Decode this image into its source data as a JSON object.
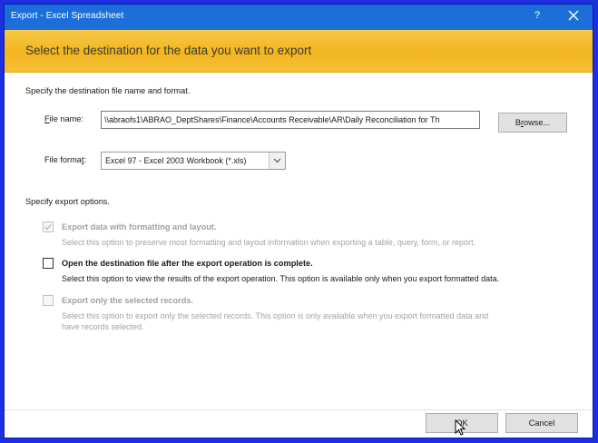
{
  "window": {
    "title": "Export - Excel Spreadsheet",
    "help_label": "?",
    "title_color": "#1c6fd8",
    "banner_color": "#f2b51d"
  },
  "banner": {
    "heading": "Select the destination for the data you want to export"
  },
  "destination": {
    "section_label": "Specify the destination file name and format.",
    "file_name_label_pre": "",
    "file_name_label_accel": "F",
    "file_name_label_post": "ile name:",
    "file_name_value": "\\\\abraofs1\\ABRAO_DeptShares\\Finance\\Accounts Receivable\\AR\\Daily Reconciliation for Th",
    "browse_label_pre": "B",
    "browse_label_accel": "r",
    "browse_label_post": "owse...",
    "file_format_label_pre": "File forma",
    "file_format_label_accel": "t",
    "file_format_label_post": ":",
    "file_format_value": "Excel 97 - Excel 2003 Workbook (*.xls)"
  },
  "export_options": {
    "section_label": "Specify export options.",
    "options": [
      {
        "label": "Export data with formatting and layout.",
        "description": "Select this option to preserve most formatting and layout information when exporting a table, query, form, or report.",
        "checked": true,
        "enabled": false
      },
      {
        "label": "Open the destination file after the export operation is complete.",
        "description": "Select this option to view the results of the export operation. This option is available only when you export formatted data.",
        "checked": false,
        "enabled": true
      },
      {
        "label": "Export only the selected records.",
        "description_line1": "Select this option to export only the selected records. This option is only available when you export formatted data and",
        "description_line2": "have records selected.",
        "checked": false,
        "enabled": false
      }
    ]
  },
  "footer": {
    "ok_label": "OK",
    "cancel_label": "Cancel"
  },
  "icons": {
    "close": "close-icon",
    "dropdown": "chevron-down-icon",
    "cursor": "mouse-pointer-icon"
  }
}
